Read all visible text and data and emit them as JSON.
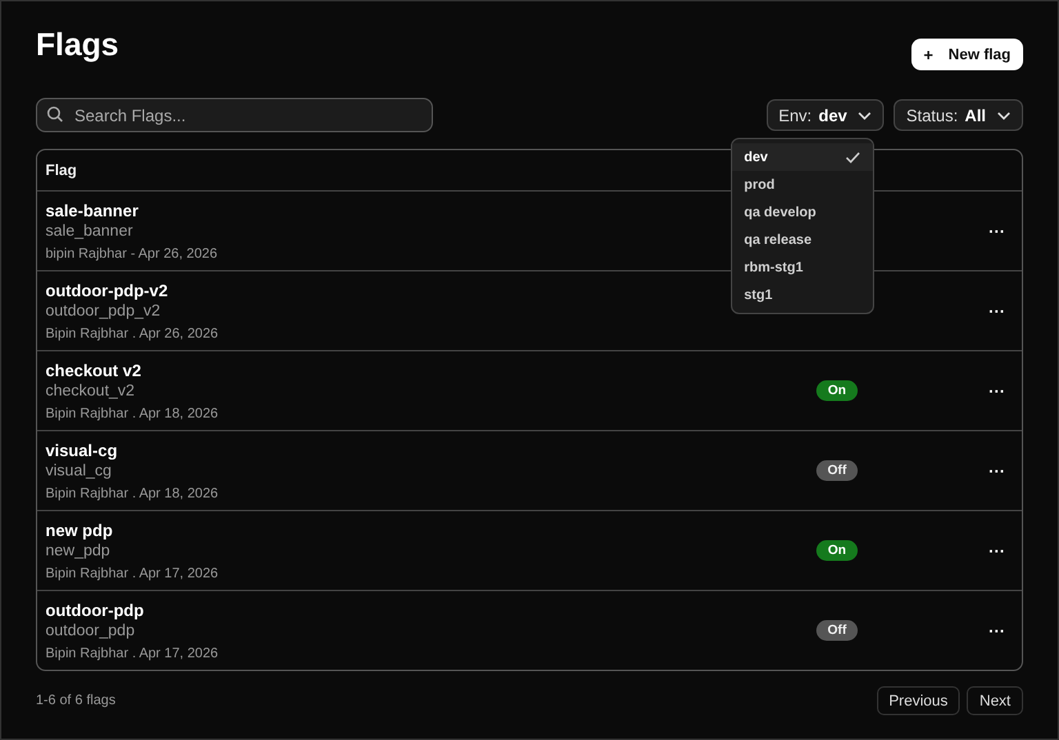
{
  "title": "Flags",
  "new_button": {
    "icon": "+",
    "label": "New flag"
  },
  "search": {
    "placeholder": "Search Flags..."
  },
  "filters": [
    {
      "label": "Env:",
      "value": "dev"
    },
    {
      "label": "Status:",
      "value": "All"
    }
  ],
  "env_menu": [
    {
      "label": "dev",
      "selected": true
    },
    {
      "label": "prod",
      "selected": false
    },
    {
      "label": "qa develop",
      "selected": false
    },
    {
      "label": "qa release",
      "selected": false
    },
    {
      "label": "rbm-stg1",
      "selected": false
    },
    {
      "label": "stg1",
      "selected": false
    }
  ],
  "table": {
    "columns": [
      "Flag"
    ],
    "rows": [
      {
        "name": "sale-banner",
        "key": "sale_banner",
        "meta": "bipin Rajbhar - Apr 26, 2026",
        "menu": "···"
      },
      {
        "name": "outdoor-pdp-v2",
        "key": "outdoor_pdp_v2",
        "meta": "Bipin Rajbhar . Apr 26, 2026",
        "menu": "···"
      },
      {
        "name": "checkout v2",
        "key": "checkout_v2",
        "meta": "Bipin Rajbhar . Apr 18, 2026",
        "status": {
          "label": "On",
          "on": true
        },
        "menu": "···"
      },
      {
        "name": "visual-cg",
        "key": "visual_cg",
        "meta": "Bipin Rajbhar . Apr 18, 2026",
        "status": {
          "label": "Off",
          "on": false
        },
        "menu": "···"
      },
      {
        "name": "new pdp",
        "key": "new_pdp",
        "meta": "Bipin Rajbhar . Apr 17, 2026",
        "status": {
          "label": "On",
          "on": true
        },
        "menu": "···"
      },
      {
        "name": "outdoor-pdp",
        "key": "outdoor_pdp",
        "meta": "Bipin Rajbhar . Apr 17, 2026",
        "status": {
          "label": "Off",
          "on": false
        },
        "menu": "···"
      }
    ]
  },
  "footer": {
    "count": "1-6 of 6 flags",
    "buttons": [
      "Previous",
      "Next"
    ]
  }
}
